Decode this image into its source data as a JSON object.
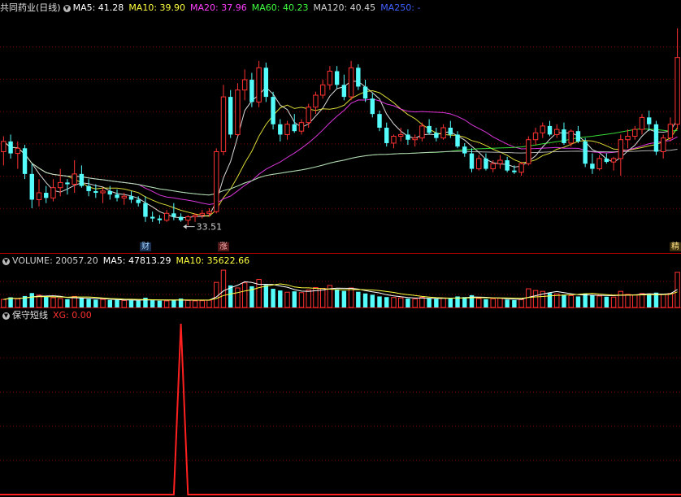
{
  "main_header": {
    "title": "共同药业(日线)",
    "items": [
      {
        "label": "MA5: 41.28",
        "color": "#ffffff"
      },
      {
        "label": "MA10: 39.90",
        "color": "#ffff40"
      },
      {
        "label": "MA20: 37.96",
        "color": "#ff40ff"
      },
      {
        "label": "MA60: 40.23",
        "color": "#40ff40"
      },
      {
        "label": "MA120: 40.45",
        "color": "#d0d0d0"
      },
      {
        "label": "MA250: -",
        "color": "#4060ff"
      }
    ]
  },
  "volume_header": {
    "items": [
      {
        "label": "VOLUME: 20057.20",
        "color": "#d0d0d0"
      },
      {
        "label": "MA5: 47813.29",
        "color": "#ffffff"
      },
      {
        "label": "MA10: 35622.66",
        "color": "#ffff40"
      }
    ]
  },
  "indicator_header": {
    "title": "保守短线",
    "items": [
      {
        "label": "XG: 0.00",
        "color": "#ff3030"
      }
    ]
  },
  "annotations": {
    "low_price": "33.51",
    "badge_cai": "财",
    "badge_zhang": "涨",
    "badge_right": "精"
  },
  "colors": {
    "up": "#ff3232",
    "down": "#54fcfc",
    "grid": "#7a0000",
    "signal": "#ff2020"
  },
  "chart_data": {
    "type": "candlestick",
    "candles": [
      [
        37.6,
        38.5,
        36.8,
        38.2
      ],
      [
        38.2,
        38.6,
        37.2,
        37.5
      ],
      [
        37.5,
        38.2,
        36.6,
        37.8
      ],
      [
        37.8,
        38.0,
        36.0,
        36.3
      ],
      [
        36.3,
        36.9,
        34.3,
        34.8
      ],
      [
        34.8,
        36.0,
        34.4,
        35.2
      ],
      [
        35.2,
        35.6,
        34.6,
        34.9
      ],
      [
        34.9,
        36.0,
        34.7,
        35.5
      ],
      [
        35.5,
        36.6,
        35.0,
        35.8
      ],
      [
        35.8,
        36.0,
        35.1,
        35.7
      ],
      [
        35.7,
        37.1,
        35.2,
        36.3
      ],
      [
        36.3,
        36.8,
        35.5,
        35.6
      ],
      [
        35.6,
        36.0,
        35.0,
        35.3
      ],
      [
        35.3,
        35.7,
        34.9,
        35.2
      ],
      [
        35.2,
        35.5,
        34.6,
        35.3
      ],
      [
        35.3,
        35.6,
        34.8,
        35.1
      ],
      [
        35.1,
        35.4,
        34.7,
        34.9
      ],
      [
        34.9,
        35.2,
        34.5,
        35.0
      ],
      [
        35.0,
        35.3,
        34.6,
        34.8
      ],
      [
        34.8,
        35.0,
        34.4,
        34.6
      ],
      [
        34.6,
        35.0,
        33.5,
        33.8
      ],
      [
        33.8,
        34.1,
        33.5,
        33.7
      ],
      [
        33.7,
        33.9,
        33.4,
        33.6
      ],
      [
        33.6,
        34.2,
        33.5,
        34.0
      ],
      [
        34.0,
        34.6,
        33.6,
        33.8
      ],
      [
        33.8,
        34.0,
        33.51,
        33.6
      ],
      [
        33.6,
        33.9,
        33.3,
        33.8
      ],
      [
        33.8,
        34.0,
        33.5,
        33.9
      ],
      [
        33.9,
        34.2,
        33.7,
        34.0
      ],
      [
        34.0,
        34.3,
        33.8,
        34.1
      ],
      [
        34.1,
        37.8,
        34.0,
        37.6
      ],
      [
        37.6,
        41.5,
        37.4,
        40.8
      ],
      [
        40.8,
        41.2,
        38.4,
        38.6
      ],
      [
        38.6,
        41.6,
        38.5,
        41.2
      ],
      [
        41.2,
        42.4,
        40.6,
        41.8
      ],
      [
        41.8,
        42.2,
        40.2,
        40.5
      ],
      [
        40.5,
        42.9,
        40.2,
        42.5
      ],
      [
        42.5,
        42.8,
        40.5,
        40.8
      ],
      [
        40.8,
        41.1,
        38.9,
        39.2
      ],
      [
        39.2,
        39.5,
        38.2,
        38.6
      ],
      [
        38.6,
        39.4,
        38.3,
        39.2
      ],
      [
        39.2,
        39.8,
        38.7,
        38.8
      ],
      [
        38.8,
        39.5,
        38.6,
        39.3
      ],
      [
        39.3,
        40.4,
        39.0,
        40.2
      ],
      [
        40.2,
        41.1,
        39.8,
        40.9
      ],
      [
        40.9,
        41.8,
        40.7,
        41.5
      ],
      [
        41.5,
        42.6,
        41.2,
        42.3
      ],
      [
        42.3,
        42.6,
        41.3,
        41.5
      ],
      [
        41.5,
        42.1,
        40.6,
        40.8
      ],
      [
        40.8,
        42.9,
        40.6,
        42.5
      ],
      [
        42.5,
        42.7,
        41.2,
        41.4
      ],
      [
        41.4,
        41.8,
        40.5,
        40.7
      ],
      [
        40.7,
        41.0,
        39.6,
        39.8
      ],
      [
        39.8,
        40.0,
        38.8,
        39.0
      ],
      [
        39.0,
        39.3,
        37.9,
        38.1
      ],
      [
        38.1,
        38.6,
        37.8,
        38.5
      ],
      [
        38.5,
        39.0,
        38.2,
        38.6
      ],
      [
        38.6,
        38.9,
        38.0,
        38.3
      ],
      [
        38.3,
        38.6,
        37.9,
        38.4
      ],
      [
        38.4,
        39.3,
        38.2,
        39.1
      ],
      [
        39.1,
        39.5,
        38.6,
        38.7
      ],
      [
        38.7,
        39.0,
        38.2,
        38.4
      ],
      [
        38.4,
        39.2,
        38.3,
        39.0
      ],
      [
        39.0,
        39.4,
        38.4,
        38.6
      ],
      [
        38.6,
        38.8,
        37.8,
        37.9
      ],
      [
        37.9,
        38.1,
        37.3,
        37.5
      ],
      [
        37.5,
        37.8,
        36.4,
        36.6
      ],
      [
        36.6,
        37.4,
        36.5,
        37.2
      ],
      [
        37.2,
        37.5,
        36.5,
        36.6
      ],
      [
        36.6,
        37.1,
        36.4,
        36.9
      ],
      [
        36.9,
        37.4,
        36.6,
        37.1
      ],
      [
        37.1,
        37.3,
        36.4,
        36.5
      ],
      [
        36.5,
        36.8,
        36.3,
        36.4
      ],
      [
        36.4,
        37.0,
        36.2,
        36.9
      ],
      [
        36.9,
        38.5,
        36.8,
        38.3
      ],
      [
        38.3,
        39.0,
        38.0,
        38.7
      ],
      [
        38.7,
        39.3,
        38.4,
        39.1
      ],
      [
        39.1,
        39.4,
        38.5,
        38.6
      ],
      [
        38.6,
        39.2,
        38.4,
        38.9
      ],
      [
        38.9,
        39.3,
        38.0,
        38.1
      ],
      [
        38.1,
        38.9,
        37.9,
        38.8
      ],
      [
        38.8,
        39.1,
        38.1,
        38.2
      ],
      [
        38.2,
        38.4,
        36.7,
        36.9
      ],
      [
        36.9,
        37.5,
        36.3,
        36.6
      ],
      [
        36.6,
        37.4,
        36.5,
        37.2
      ],
      [
        37.2,
        37.5,
        36.9,
        37.0
      ],
      [
        37.0,
        37.3,
        36.5,
        37.2
      ],
      [
        37.2,
        38.6,
        36.2,
        38.3
      ],
      [
        38.3,
        38.9,
        37.8,
        38.5
      ],
      [
        38.5,
        39.1,
        38.3,
        38.9
      ],
      [
        38.9,
        39.8,
        38.6,
        39.6
      ],
      [
        39.6,
        40.0,
        38.8,
        39.2
      ],
      [
        39.2,
        39.4,
        37.4,
        37.6
      ],
      [
        37.6,
        38.6,
        37.2,
        38.4
      ],
      [
        38.4,
        39.6,
        38.2,
        39.2
      ],
      [
        39.2,
        44.8,
        38.9,
        43.1
      ]
    ],
    "volume": [
      19000,
      24000,
      20000,
      27000,
      34000,
      29000,
      25000,
      23000,
      21000,
      19500,
      26000,
      22000,
      20000,
      18500,
      19000,
      17500,
      18000,
      16500,
      17000,
      16000,
      23000,
      17000,
      16000,
      15500,
      17500,
      21000,
      16500,
      15500,
      16000,
      17000,
      59000,
      88000,
      52000,
      46000,
      58000,
      50000,
      66000,
      53000,
      44000,
      40000,
      36000,
      38000,
      35000,
      41000,
      47000,
      45000,
      52000,
      43000,
      39000,
      46000,
      37000,
      33000,
      30000,
      26000,
      24500,
      23500,
      22500,
      21000,
      20000,
      24000,
      21000,
      20000,
      22500,
      21500,
      26000,
      24500,
      29000,
      21000,
      19500,
      20500,
      21500,
      18500,
      17500,
      18500,
      44000,
      40000,
      38000,
      34000,
      32000,
      30000,
      28000,
      26000,
      33000,
      29000,
      27000,
      25500,
      24500,
      38000,
      31000,
      29500,
      33000,
      30000,
      35000,
      31000,
      33000,
      83000
    ],
    "signal": {
      "index": 25,
      "value": 1
    },
    "price_ylim": [
      32.4,
      45.6
    ],
    "volume_ylim": [
      0,
      92000
    ],
    "signal_ylim": [
      0,
      1
    ],
    "low_marker_index": 25,
    "badge_cai_index": 20,
    "badge_zhang_index": 31
  }
}
